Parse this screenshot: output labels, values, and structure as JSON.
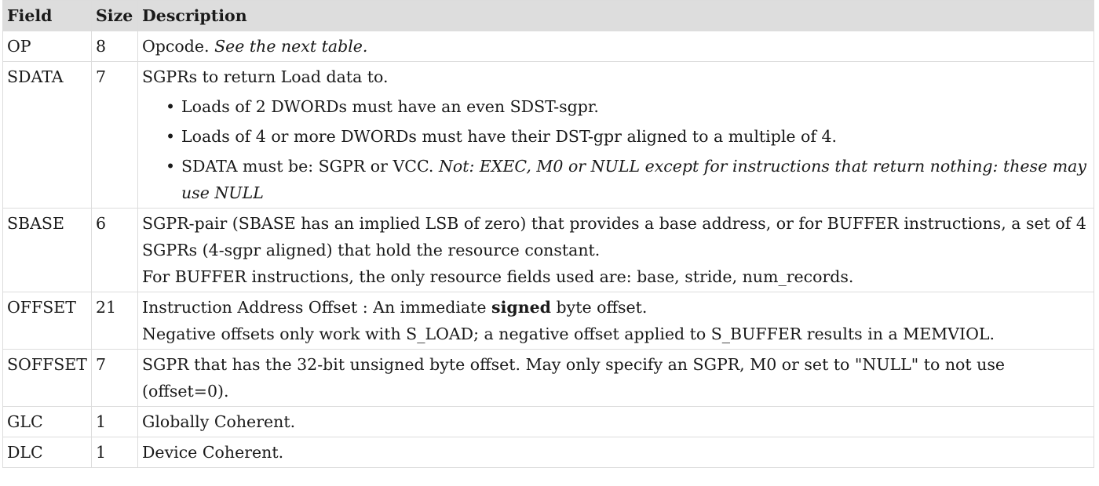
{
  "table": {
    "headers": {
      "field": "Field",
      "size": "Size",
      "description": "Description"
    },
    "rows": {
      "op": {
        "field": "OP",
        "size": "8",
        "desc_text": "Opcode.",
        "desc_italic": "See the next table."
      },
      "sdata": {
        "field": "SDATA",
        "size": "7",
        "desc_text": "SGPRs to return Load data to.",
        "bullet_1": "Loads of 2 DWORDs must have an even SDST-sgpr.",
        "bullet_2": "Loads of 4 or more DWORDs must have their DST-gpr aligned to a multiple of 4.",
        "bullet_3_text": "SDATA must be: SGPR or VCC.",
        "bullet_3_italic": "Not: EXEC, M0 or NULL except for instructions that return nothing: these may use NULL"
      },
      "sbase": {
        "field": "SBASE",
        "size": "6",
        "desc_line_1": "SGPR-pair (SBASE has an implied LSB of zero) that provides a base address, or for BUFFER instructions, a set of 4 SGPRs (4-sgpr aligned) that hold the resource constant.",
        "desc_line_2": "For BUFFER instructions, the only resource fields used are: base, stride, num_records."
      },
      "offset": {
        "field": "OFFSET",
        "size": "21",
        "desc_pre": "Instruction Address Offset : An immediate",
        "desc_bold": "signed",
        "desc_post": "byte offset.",
        "desc_line_2": "Negative offsets only work with S_LOAD; a negative offset applied to S_BUFFER results in a MEMVIOL."
      },
      "soffset": {
        "field": "SOFFSET",
        "size": "7",
        "desc_text": "SGPR that has the 32-bit unsigned byte offset. May only specify an SGPR, M0 or set to \"NULL\" to not use (offset=0)."
      },
      "glc": {
        "field": "GLC",
        "size": "1",
        "desc_text": "Globally Coherent."
      },
      "dlc": {
        "field": "DLC",
        "size": "1",
        "desc_text": "Device Coherent."
      }
    }
  }
}
